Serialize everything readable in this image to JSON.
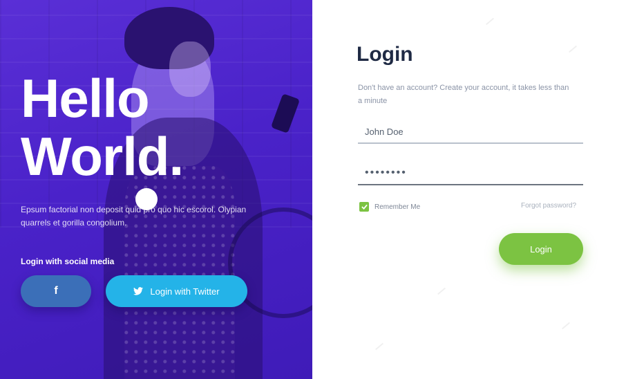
{
  "hero": {
    "title_line1": "Hello",
    "title_line2": "World.",
    "description": "Epsum factorial non deposit quid pro quo hic escorol. Olypian quarrels et gorilla congolium.",
    "social_label": "Login with social media",
    "facebook_icon": "facebook-icon",
    "facebook_glyph": "f",
    "twitter_icon": "twitter-icon",
    "twitter_label": "Login with Twitter",
    "colors": {
      "background": "#4a22c9",
      "facebook": "#3b6fb8",
      "twitter": "#24b3e8"
    }
  },
  "login": {
    "title": "Login",
    "subtitle": "Don't have an account? Create your account, it takes less than a minute",
    "username_value": "John Doe",
    "password_value": "••••••••",
    "remember_label": "Remember Me",
    "remember_checked": true,
    "forgot_label": "Forgot password?",
    "submit_label": "Login",
    "colors": {
      "accent": "#7cc342",
      "title": "#1f2a44"
    }
  }
}
